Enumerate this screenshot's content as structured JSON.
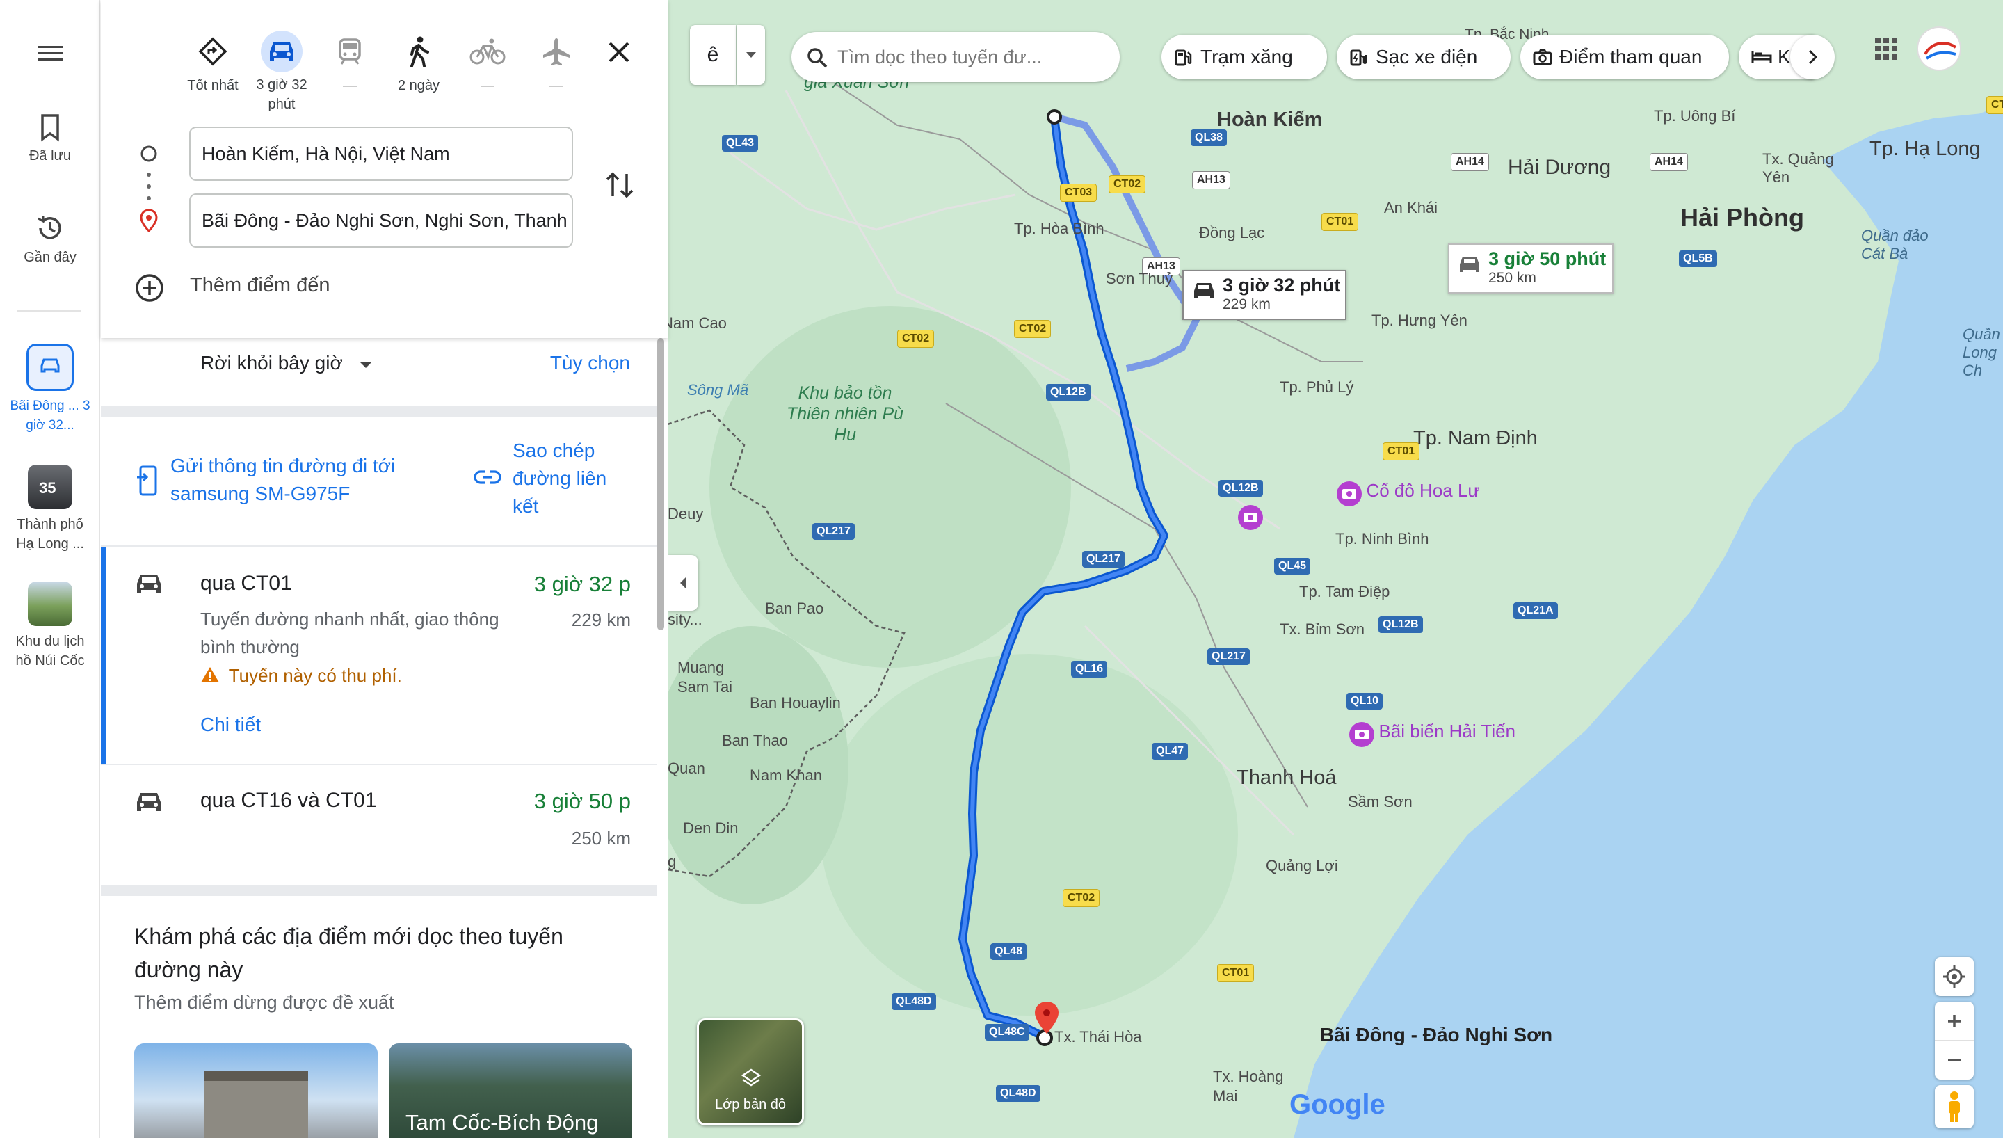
{
  "rail": {
    "saved": "Đã lưu",
    "recent": "Gần đây",
    "active_route": "Bãi Đông ... 3 giờ 32...",
    "recents": [
      {
        "label": "Thành phố Hạ Long ...",
        "badge": "35"
      },
      {
        "label": "Khu du lịch hồ Núi Cốc"
      }
    ]
  },
  "modes": [
    {
      "label": "Tốt nhất",
      "icon": "best-route-icon"
    },
    {
      "label": "3 giờ 32 phút",
      "icon": "car-icon",
      "active": true
    },
    {
      "label": "—",
      "icon": "train-icon"
    },
    {
      "label": "2 ngày",
      "icon": "walk-icon"
    },
    {
      "label": "—",
      "icon": "bike-icon"
    },
    {
      "label": "—",
      "icon": "plane-icon"
    }
  ],
  "origin": "Hoàn Kiếm, Hà Nội, Việt Nam",
  "destination": "Bãi Đông - Đảo Nghi Sơn, Nghi Sơn, Thanh",
  "add_destination": "Thêm điểm đến",
  "depart": {
    "label": "Rời khỏi bây giờ",
    "options": "Tùy chọn"
  },
  "share": {
    "send_to_device": "Gửi thông tin đường đi tới samsung SM-G975F",
    "copy_link": "Sao chép đường liên kết"
  },
  "routes": [
    {
      "title": "qua CT01",
      "time": "3 giờ 32 p",
      "distance": "229 km",
      "desc": "Tuyến đường nhanh nhất, giao thông bình thường",
      "warning": "Tuyến này có thu phí.",
      "details": "Chi tiết"
    },
    {
      "title": "qua CT16 và CT01",
      "time": "3 giờ 50 p",
      "distance": "250 km"
    }
  ],
  "explore": {
    "title": "Khám phá các địa điểm mới dọc theo tuyến đường này",
    "subtitle": "Thêm điểm dừng được đề xuất",
    "cards": [
      "",
      "Tam Cốc-Bích Động"
    ]
  },
  "map": {
    "search_placeholder": "Tìm dọc theo tuyến đư...",
    "chips": [
      "Trạm xăng",
      "Sạc xe điện",
      "Điểm tham quan",
      "Kh"
    ],
    "route_main": {
      "time": "3 giờ 32 phút",
      "distance": "229 km"
    },
    "route_alt": {
      "time": "3 giờ 50 phút",
      "distance": "250 km"
    },
    "layers": "Lớp bản đồ",
    "google": "Google",
    "toggle_label": "ê",
    "labels": {
      "hoan_kiem": "Hoàn Kiếm",
      "hai_duong": "Hải Dương",
      "hai_phong": "Hải Phòng",
      "ha_long": "Tp. Hạ Long",
      "uong_bi": "Tp. Uông Bí",
      "quang_yen": "Tx. Quảng Yên",
      "an_khai": "An Khái",
      "dong_lac": "Đồng Lạc",
      "hoa_binh": "Tp. Hòa Bình",
      "son_thuy": "Sơn Thuỷ",
      "hung_yen": "Tp. Hưng Yên",
      "phu_ly": "Tp. Phủ Lý",
      "nam_dinh": "Tp. Nam Định",
      "ninh_binh": "Tp. Ninh Bình",
      "tam_diep": "Tp. Tam Điệp",
      "bim_son": "Tx. Bỉm Sơn",
      "thanh_hoa": "Thanh Hoá",
      "sam_son": "Sầm Sơn",
      "quang_loi": "Quảng Lợi",
      "thai_hoa": "Tx. Thái Hòa",
      "hoang_mai": "Tx. Hoàng Mai",
      "nam_cao": "Nam Cao",
      "song_ma": "Sông Mã",
      "pu_hu": "Khu bảo tồn Thiên nhiên Pù Hu",
      "deuy": "Deuy",
      "ban_pao": "Ban Pao",
      "muang_sam_tai": "Muang Sam Tai",
      "ban_houaylin": "Ban Houaylin",
      "ban_thao": "Ban Thao",
      "nam_khan": "Nam Khan",
      "quan": "Quan",
      "den_din": "Den Din",
      "sity": "sity...",
      "xuan_son": "gia Xuân Sơn",
      "quan_dao_cat_ba": "Quần đảo Cát Bà",
      "quan_long_chau": "Quần đ Long Ch",
      "co_do_hoa_lu": "Cố đô Hoa Lư",
      "bai_bien_hai_tien": "Bãi biển Hải Tiến",
      "bai_dong": "Bãi Đông - Đảo Nghi Sơn",
      "bac_ninh": "Tp. Bắc Ninh",
      "g": "g"
    },
    "shields": [
      "QL43",
      "CT03",
      "CT02",
      "AH13",
      "AH13",
      "QL38",
      "AH14",
      "AH14",
      "CT01",
      "QL5B",
      "CT02",
      "CT02",
      "QL12B",
      "CT01",
      "QL12B",
      "QL45",
      "QL217",
      "QL217",
      "QL12B",
      "QL21A",
      "QL217",
      "QL16",
      "QL10",
      "QL47",
      "CT02",
      "QL48",
      "CT01",
      "QL48D",
      "QL48C",
      "QL48D",
      "8C",
      "CT"
    ]
  }
}
